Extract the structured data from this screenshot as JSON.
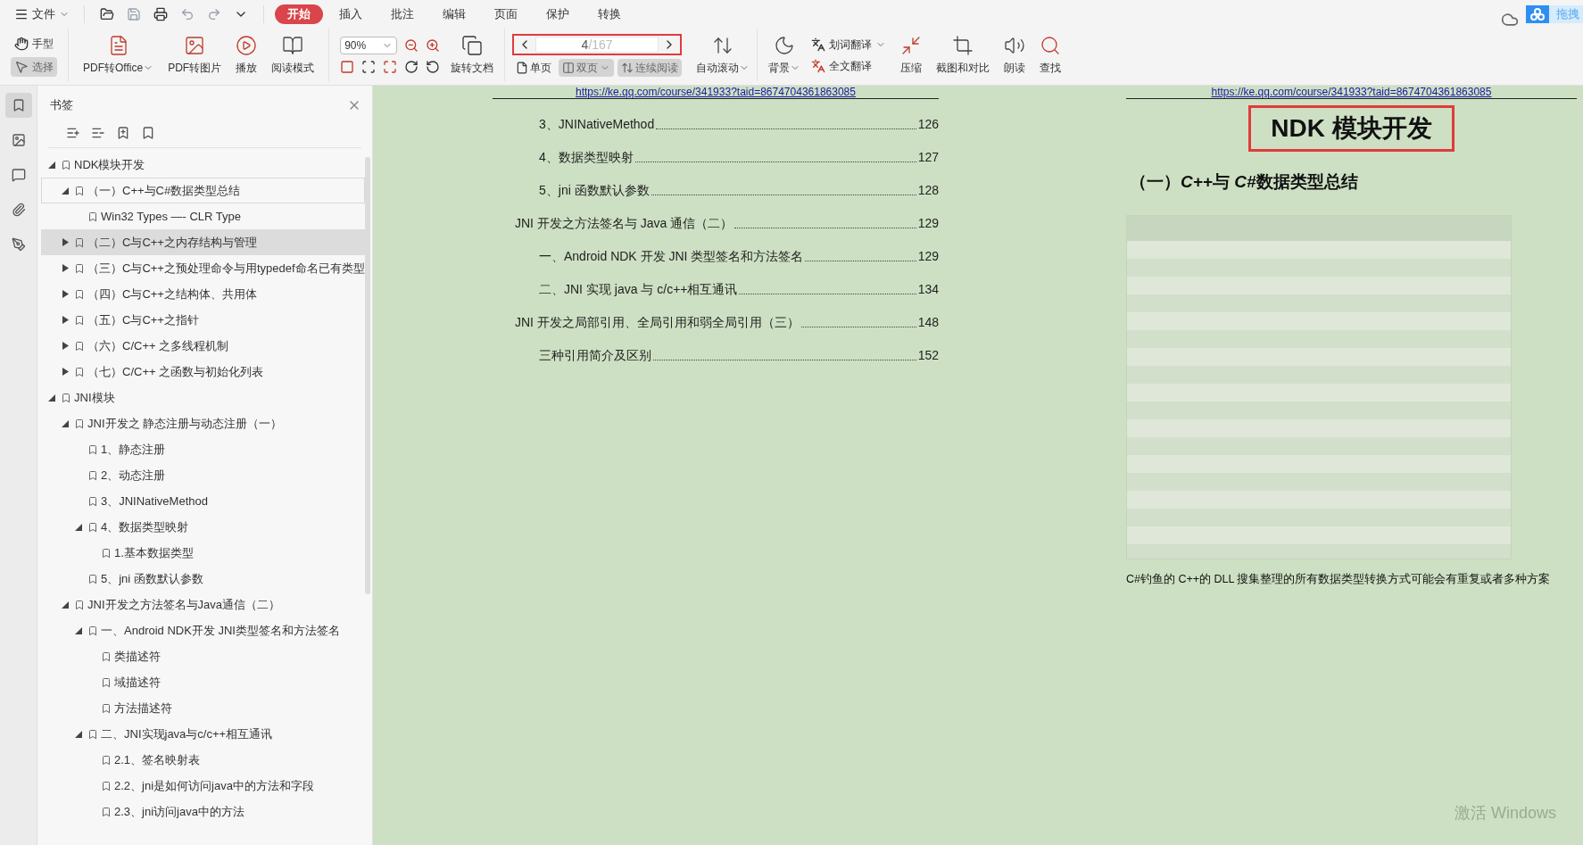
{
  "menu": {
    "file_label": "文件",
    "tabs": [
      {
        "label": "开始",
        "selected": true
      },
      {
        "label": "插入",
        "selected": false
      },
      {
        "label": "批注",
        "selected": false
      },
      {
        "label": "编辑",
        "selected": false
      },
      {
        "label": "页面",
        "selected": false
      },
      {
        "label": "保护",
        "selected": false
      },
      {
        "label": "转换",
        "selected": false
      }
    ]
  },
  "cloud_widget": {
    "label": "拖拽"
  },
  "toolbar": {
    "modes": [
      {
        "label": "手型",
        "selected": false
      },
      {
        "label": "选择",
        "selected": true
      }
    ],
    "big_buttons": [
      {
        "label": "PDF转Office",
        "dropdown": true
      },
      {
        "label": "PDF转图片",
        "dropdown": false
      },
      {
        "label": "播放",
        "dropdown": false
      },
      {
        "label": "阅读模式",
        "dropdown": false
      }
    ],
    "zoom": {
      "value": "90%"
    },
    "rotate": {
      "label": "旋转文档"
    },
    "page_nav": {
      "current": "4",
      "total": "/167"
    },
    "view_modes": [
      {
        "label": "单页",
        "selected": false,
        "dropdown": false
      },
      {
        "label": "双页",
        "selected": true,
        "dropdown": true
      },
      {
        "label": "连续阅读",
        "selected": true,
        "dropdown": false
      }
    ],
    "auto_scroll": {
      "label": "自动滚动"
    },
    "background": {
      "label": "背景"
    },
    "translate": [
      {
        "label": "划词翻译",
        "dropdown": true
      },
      {
        "label": "全文翻译",
        "dropdown": false
      }
    ],
    "tools": [
      {
        "label": "压缩"
      },
      {
        "label": "截图和对比"
      },
      {
        "label": "朗读"
      },
      {
        "label": "查找"
      }
    ]
  },
  "sidebar": {
    "title": "书签",
    "rail": [
      {
        "selected": true
      },
      {
        "selected": false
      },
      {
        "selected": false
      },
      {
        "selected": false
      },
      {
        "selected": false
      }
    ],
    "bookmarks": [
      {
        "label": "NDK模块开发",
        "expanded": true,
        "selected": false,
        "focused": false,
        "children": [
          {
            "label": "（一）C++与C#数据类型总结",
            "expanded": true,
            "selected": false,
            "focused": true,
            "children": [
              {
                "label": "Win32 Types —- CLR Type",
                "selected": false,
                "focused": false
              }
            ]
          },
          {
            "label": "（二）C与C++之内存结构与管理",
            "expanded": false,
            "selected": true,
            "focused": false
          },
          {
            "label": "（三）C与C++之预处理命令与用typedef命名已有类型",
            "expanded": false,
            "selected": false,
            "focused": false
          },
          {
            "label": "（四）C与C++之结构体、共用体",
            "expanded": false,
            "selected": false,
            "focused": false
          },
          {
            "label": "（五）C与C++之指针",
            "expanded": false,
            "selected": false,
            "focused": false
          },
          {
            "label": "（六）C/C++ 之多线程机制",
            "expanded": false,
            "selected": false,
            "focused": false
          },
          {
            "label": "（七）C/C++ 之函数与初始化列表",
            "expanded": false,
            "selected": false,
            "focused": false
          }
        ]
      },
      {
        "label": "JNI模块",
        "expanded": true,
        "selected": false,
        "focused": false,
        "children": [
          {
            "label": "JNI开发之 静态注册与动态注册（一）",
            "expanded": true,
            "selected": false,
            "focused": false,
            "children": [
              {
                "label": "1、静态注册",
                "selected": false,
                "focused": false
              },
              {
                "label": "2、动态注册",
                "selected": false,
                "focused": false
              },
              {
                "label": "3、JNINativeMethod",
                "selected": false,
                "focused": false
              },
              {
                "label": "4、数据类型映射",
                "expanded": true,
                "selected": false,
                "focused": false,
                "children": [
                  {
                    "label": "1.基本数据类型",
                    "selected": false,
                    "focused": false
                  }
                ]
              },
              {
                "label": "5、jni 函数默认参数",
                "selected": false,
                "focused": false
              }
            ]
          },
          {
            "label": "JNI开发之方法签名与Java通信（二）",
            "expanded": true,
            "selected": false,
            "focused": false,
            "children": [
              {
                "label": "一、Android NDK开发 JNI类型签名和方法签名",
                "expanded": true,
                "selected": false,
                "focused": false,
                "children": [
                  {
                    "label": "类描述符",
                    "selected": false,
                    "focused": false
                  },
                  {
                    "label": "域描述符",
                    "selected": false,
                    "focused": false
                  },
                  {
                    "label": "方法描述符",
                    "selected": false,
                    "focused": false
                  }
                ]
              },
              {
                "label": "二、JNI实现java与c/c++相互通讯",
                "expanded": true,
                "selected": false,
                "focused": false,
                "children": [
                  {
                    "label": "2.1、签名映射表",
                    "selected": false,
                    "focused": false
                  },
                  {
                    "label": "2.2、jni是如何访问java中的方法和字段",
                    "selected": false,
                    "focused": false
                  },
                  {
                    "label": "2.3、jni访问java中的方法",
                    "selected": false,
                    "focused": false
                  }
                ]
              }
            ]
          }
        ]
      }
    ]
  },
  "left_page": {
    "link": "https://ke.qq.com/course/341933?taid=8674704361863085",
    "toc": [
      {
        "children": [
          {
            "title": "3、JNINativeMethod",
            "page": "126"
          },
          {
            "title": "4、数据类型映射",
            "page": "127"
          },
          {
            "title": "5、jni  函数默认参数",
            "page": "128"
          }
        ]
      },
      {
        "title": "JNI 开发之方法签名与 Java 通信（二）",
        "page": "129",
        "children": [
          {
            "title": "一、Android NDK 开发  JNI 类型签名和方法签名",
            "page": "129"
          },
          {
            "title": "二、JNI 实现 java 与 c/c++相互通讯",
            "page": "134"
          }
        ]
      },
      {
        "title": "JNI 开发之局部引用、全局引用和弱全局引用（三）",
        "page": "148",
        "children": [
          {
            "title": "三种引用简介及区别",
            "page": "152"
          }
        ]
      }
    ]
  },
  "right_page": {
    "link": "https://ke.qq.com/course/341933?taid=8674704361863085",
    "title": "NDK 模块开发",
    "heading": [
      {
        "text": "（一）",
        "italic": false
      },
      {
        "text": "C++",
        "italic": true
      },
      {
        "text": "与 ",
        "italic": false
      },
      {
        "text": "C#",
        "italic": true
      },
      {
        "text": "数据类型总结",
        "italic": false
      }
    ],
    "caption": "C#钓鱼的 C++的 DLL 搜集整理的所有数据类型转换方式可能会有重复或者多种方案"
  },
  "activation_notice": "激活 Windows"
}
